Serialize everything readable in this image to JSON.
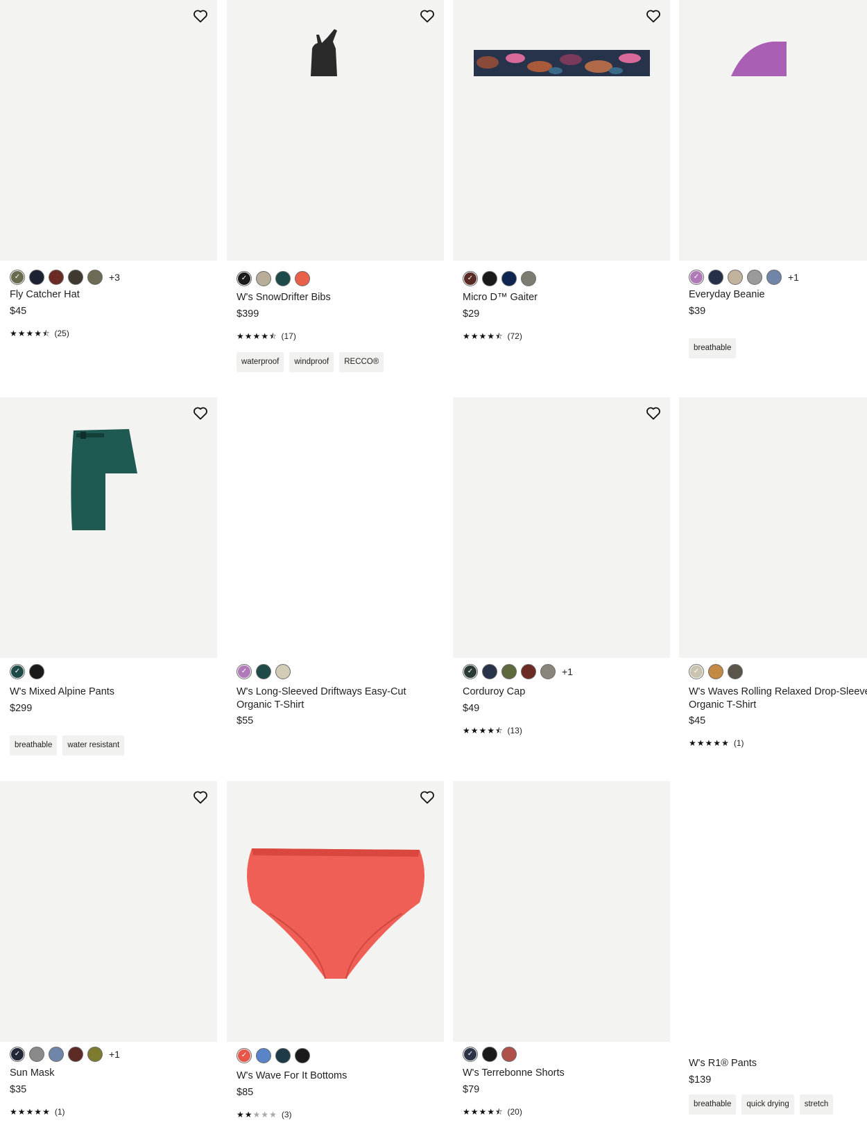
{
  "products": [
    {
      "name": "Fly Catcher Hat",
      "price": "$45",
      "colors": [
        "#6a6a4e",
        "#1c2233",
        "#6b2b24",
        "#3e3a30",
        "#6d6a56"
      ],
      "more": "+3",
      "rating": {
        "stars": 4.5,
        "count": "(25)"
      },
      "tags": [],
      "favorite": true
    },
    {
      "name": "W's SnowDrifter Bibs",
      "price": "$399",
      "colors": [
        "#1a1a1a",
        "#b8ad98",
        "#1e4a4a",
        "#e8604a"
      ],
      "more": "",
      "rating": {
        "stars": 4.5,
        "count": "(17)"
      },
      "tags": [
        "waterproof",
        "windproof",
        "RECCO®"
      ],
      "favorite": true
    },
    {
      "name": "Micro D™ Gaiter",
      "price": "$29",
      "colors": [
        "#5a2b25",
        "#1a1a1a",
        "#0e2550",
        "#7c7c70"
      ],
      "more": "",
      "rating": {
        "stars": 4.5,
        "count": "(72)"
      },
      "tags": [],
      "favorite": true
    },
    {
      "name": "Everyday Beanie",
      "price": "$39",
      "colors": [
        "#b07ab8",
        "#25304a",
        "#c2b49c",
        "#9a9a9a",
        "#6f86a8"
      ],
      "more": "+1",
      "rating": null,
      "tags": [
        "breathable"
      ],
      "favorite": false
    },
    {
      "name": "W's Mixed Alpine Pants",
      "price": "$299",
      "colors": [
        "#1e4a48",
        "#1a1a1a"
      ],
      "more": "",
      "rating": null,
      "tags": [
        "breathable",
        "water resistant"
      ],
      "favorite": true
    },
    {
      "name": "W's Long-Sleeved Driftways Easy-Cut Organic T-Shirt",
      "price": "$55",
      "colors": [
        "#b07ab8",
        "#1e4a48",
        "#d2cbb6"
      ],
      "more": "",
      "rating": null,
      "tags": [],
      "favorite": false
    },
    {
      "name": "Corduroy Cap",
      "price": "$49",
      "colors": [
        "#2b3a34",
        "#28334a",
        "#5e6a3e",
        "#6b2b24",
        "#8a857a"
      ],
      "more": "+1",
      "rating": {
        "stars": 4.5,
        "count": "(13)"
      },
      "tags": [],
      "favorite": true
    },
    {
      "name": "W's Waves Rolling Relaxed Drop-Sleeve Organic T-Shirt",
      "price": "$45",
      "colors": [
        "#c9c3b0",
        "#c48a44",
        "#5a5548"
      ],
      "more": "",
      "rating": {
        "stars": 5,
        "count": "(1)"
      },
      "tags": [],
      "favorite": false
    },
    {
      "name": "Sun Mask",
      "price": "$35",
      "colors": [
        "#232838",
        "#8a8a8a",
        "#6f86a8",
        "#5e2a26",
        "#7d7c2e"
      ],
      "more": "+1",
      "rating": {
        "stars": 5,
        "count": "(1)"
      },
      "tags": [],
      "favorite": true
    },
    {
      "name": "W's Wave For It Bottoms",
      "price": "$85",
      "colors": [
        "#e8564a",
        "#5a84c8",
        "#1e3a48",
        "#1a1a1a"
      ],
      "more": "",
      "rating": {
        "stars": 2,
        "count": "(3)"
      },
      "tags": [],
      "favorite": true
    },
    {
      "name": "W's Terrebonne Shorts",
      "price": "$79",
      "colors": [
        "#2d3448",
        "#1a1a1a",
        "#b0504a"
      ],
      "more": "",
      "rating": {
        "stars": 4.5,
        "count": "(20)"
      },
      "tags": [],
      "favorite": false
    },
    {
      "name": "W's R1® Pants",
      "price": "$139",
      "colors": [],
      "more": "",
      "rating": null,
      "tags": [
        "breathable",
        "quick drying",
        "stretch"
      ],
      "favorite": false
    }
  ]
}
